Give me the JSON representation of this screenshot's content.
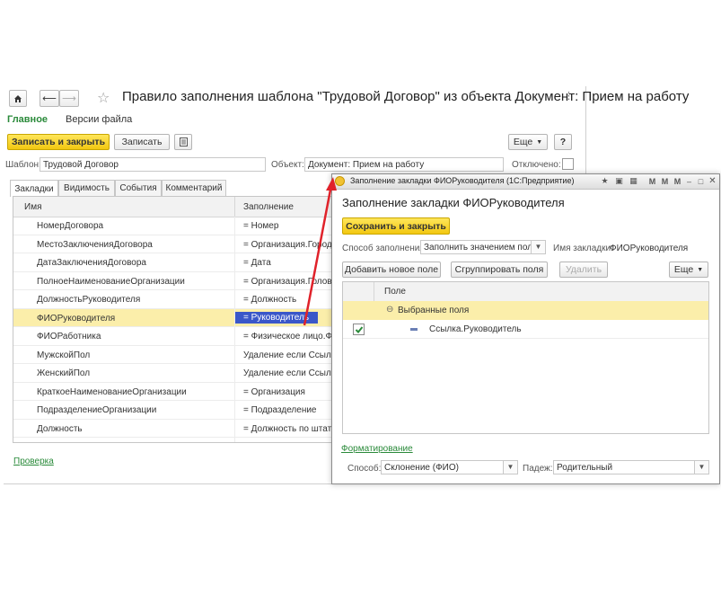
{
  "main": {
    "title": "Правило заполнения шаблона \"Трудовой Договор\" из объекта Документ: Прием на работу",
    "nav_tabs": [
      "Главное",
      "Версии файла"
    ],
    "toolbar": {
      "save_close": "Записать и закрыть",
      "save": "Записать",
      "more": "Еще"
    },
    "template_label": "Шаблон:",
    "template_value": "Трудовой Договор",
    "object_label": "Объект:",
    "object_value": "Документ: Прием на работу",
    "disabled_label": "Отключено:",
    "form_tabs": [
      "Закладки",
      "Видимость",
      "События",
      "Комментарий"
    ],
    "grid": {
      "headers": [
        "Имя",
        "Заполнение"
      ],
      "rows": [
        {
          "name": "НомерДоговора",
          "fill": "= Номер"
        },
        {
          "name": "МестоЗаключенияДоговора",
          "fill": "= Организация.Город"
        },
        {
          "name": "ДатаЗаключенияДоговора",
          "fill": "= Дата"
        },
        {
          "name": "ПолноеНаименованиеОрганизации",
          "fill": "= Организация.Головна"
        },
        {
          "name": "ДолжностьРуководителя",
          "fill": "= Должность"
        },
        {
          "name": "ФИОРуководителя",
          "fill": "= Руководитель"
        },
        {
          "name": "ФИОРаботника",
          "fill": "= Физическое лицо.ФИ"
        },
        {
          "name": "МужскойПол",
          "fill": "Удаление если Ссылка"
        },
        {
          "name": "ЖенскийПол",
          "fill": "Удаление если Ссылка"
        },
        {
          "name": "КраткоеНаименованиеОрганизации",
          "fill": "= Организация"
        },
        {
          "name": "ПодразделениеОрганизации",
          "fill": "= Подразделение"
        },
        {
          "name": "Должность",
          "fill": "= Должность по штатн"
        }
      ]
    },
    "check_link": "Проверка"
  },
  "dialog": {
    "window_title": "Заполнение закладки ФИОРуководителя (1С:Предприятие)",
    "heading": "Заполнение закладки ФИОРуководителя",
    "save_close": "Сохранить и закрыть",
    "fill_method_label": "Способ заполнения:",
    "fill_method_value": "Заполнить значением поля о",
    "bookmark_name_label": "Имя закладки:",
    "bookmark_name_value": "ФИОРуководителя",
    "add_field": "Добавить новое поле",
    "group_fields": "Сгруппировать поля",
    "delete": "Удалить",
    "more": "Еще",
    "table_header": "Поле",
    "group_row": "Выбранные поля",
    "field_row": "Ссылка.Руководитель",
    "format_link": "Форматирование",
    "method_label": "Способ:",
    "method_value": "Склонение (ФИО)",
    "case_label": "Падеж:",
    "case_value": "Родительный"
  },
  "colors": {
    "accent_green": "#2a8a3a",
    "highlight_row": "#fbeeaa",
    "selection": "#3a57c9",
    "arrow": "#e0222a",
    "button_yellow": "#f5cd1c"
  }
}
